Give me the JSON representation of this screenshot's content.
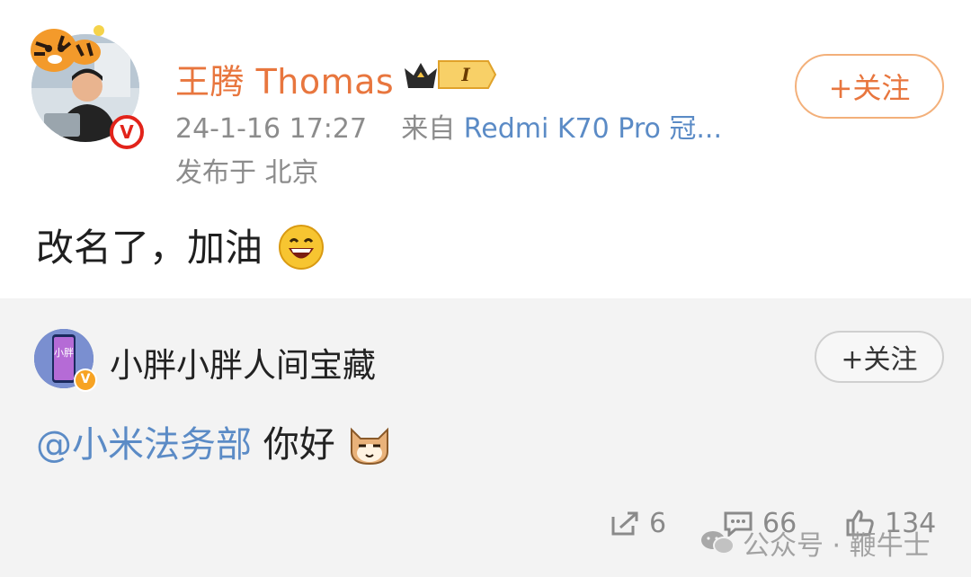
{
  "post": {
    "author": "王腾 Thomas",
    "level": "I",
    "timestamp": "24-1-16 17:27",
    "source_prefix": "来自",
    "device": "Redmi K70 Pro 冠...",
    "location": "发布于 北京",
    "follow_label": "+关注",
    "text": "改名了，加油",
    "verified_mark": "V"
  },
  "repost": {
    "author": "小胖小胖人间宝藏",
    "avatar_text": "小胖",
    "follow_label": "+关注",
    "mention": "@小米法务部",
    "text": " 你好",
    "verified_mark": "V"
  },
  "actions": {
    "share_count": "6",
    "comment_count": "66",
    "like_count": "134"
  },
  "watermark": {
    "text": "公众号 · 鞭牛士"
  },
  "colors": {
    "author_orange": "#e8763e",
    "link_blue": "#5b8bc6",
    "meta_gray": "#8c8c8c"
  }
}
